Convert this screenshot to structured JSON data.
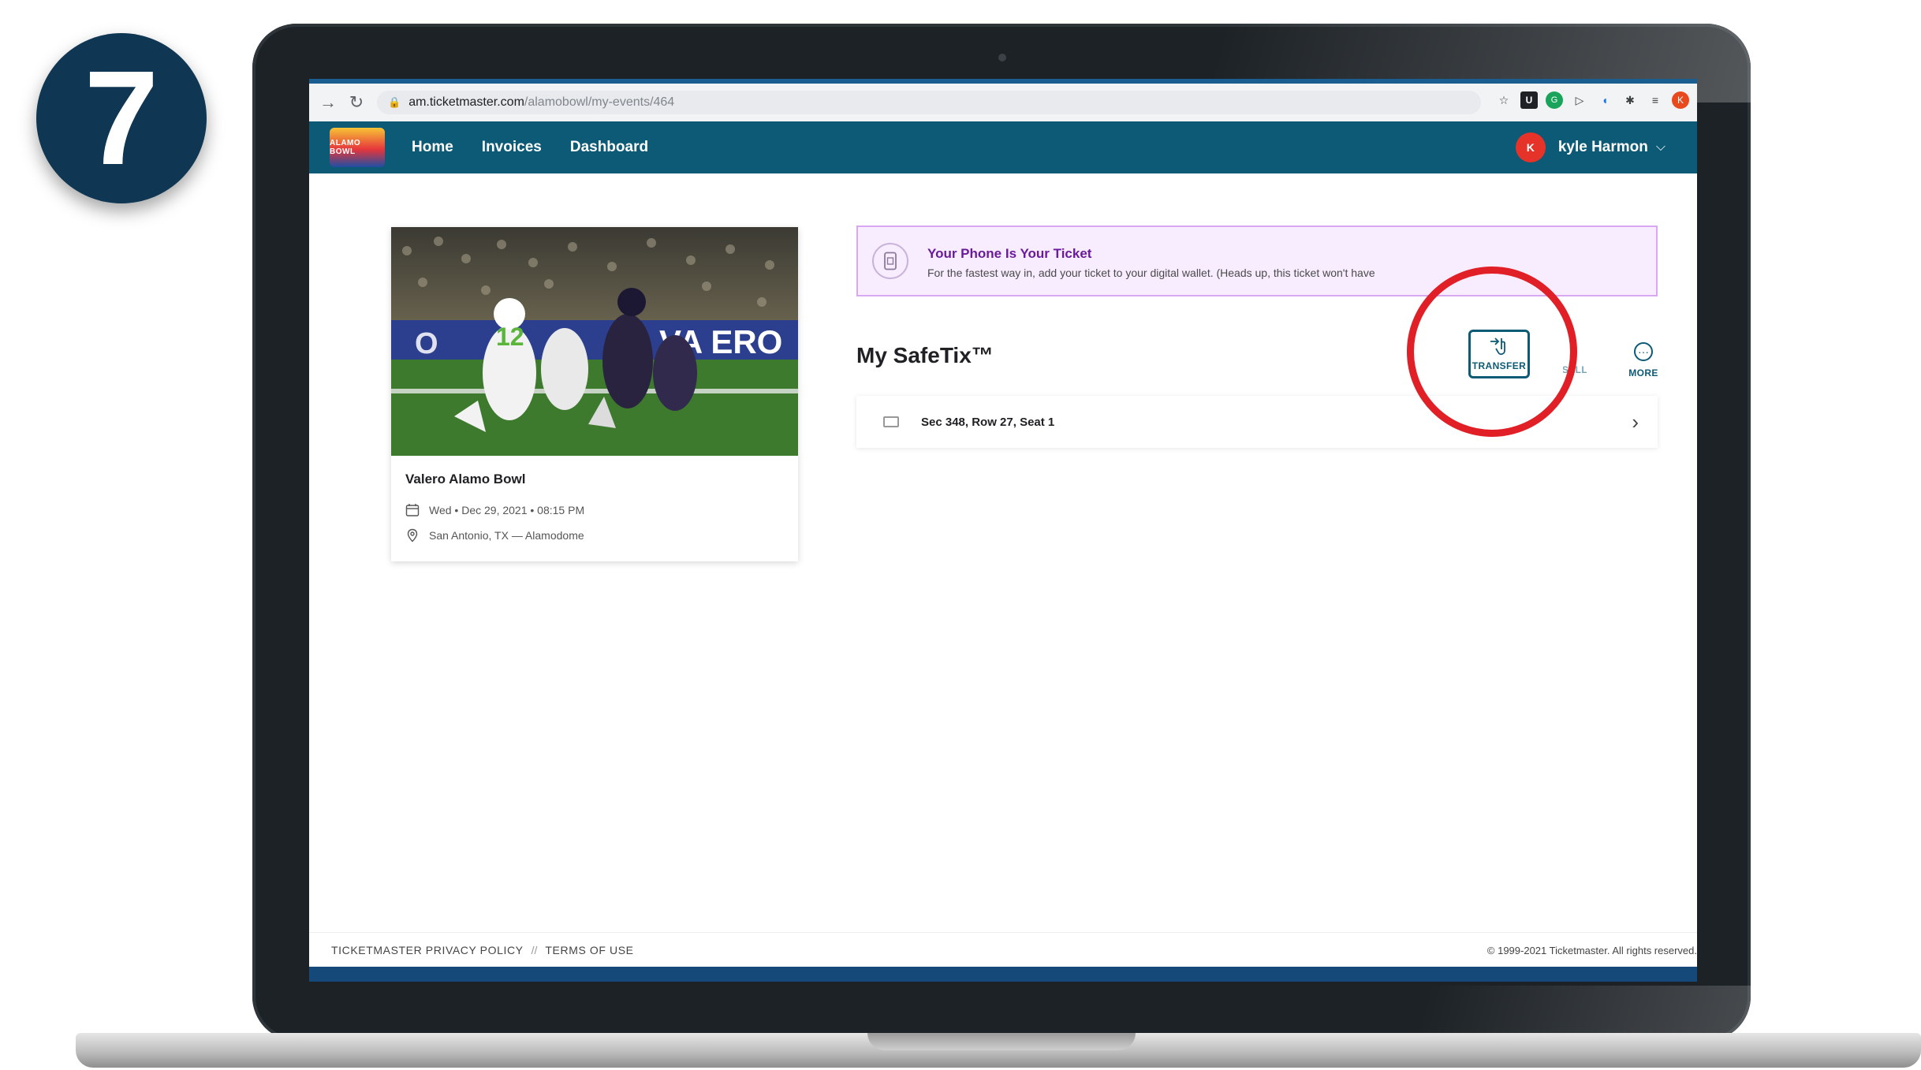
{
  "step": {
    "number": "7"
  },
  "browser": {
    "url_host": "am.ticketmaster.com",
    "url_path": "/alamobowl/my-events/464"
  },
  "header": {
    "logo_text": "ALAMO BOWL",
    "nav": [
      "Home",
      "Invoices",
      "Dashboard"
    ],
    "user": {
      "initial": "K",
      "name": "kyle Harmon"
    }
  },
  "event": {
    "title": "Valero Alamo Bowl",
    "datetime": "Wed • Dec 29, 2021 • 08:15 PM",
    "location": "San Antonio, TX — Alamodome"
  },
  "banner": {
    "title": "Your Phone Is Your Ticket",
    "text": "For the fastest way in, add your ticket to your digital wallet. (Heads up, this ticket won't have"
  },
  "safetix": {
    "title": "My SafeTix™",
    "actions": {
      "transfer": "TRANSFER",
      "sell": "SELL",
      "more": "MORE"
    },
    "ticket": "Sec 348, Row 27, Seat 1"
  },
  "footer": {
    "privacy": "TICKETMASTER PRIVACY POLICY",
    "separator": "//",
    "terms": "TERMS OF USE",
    "copyright": "© 1999-2021 Ticketmaster. All rights reserved."
  },
  "colors": {
    "header": "#0c5a76",
    "highlight": "#e01f26",
    "banner_bg": "#f8edff",
    "badge": "#0f3652"
  }
}
